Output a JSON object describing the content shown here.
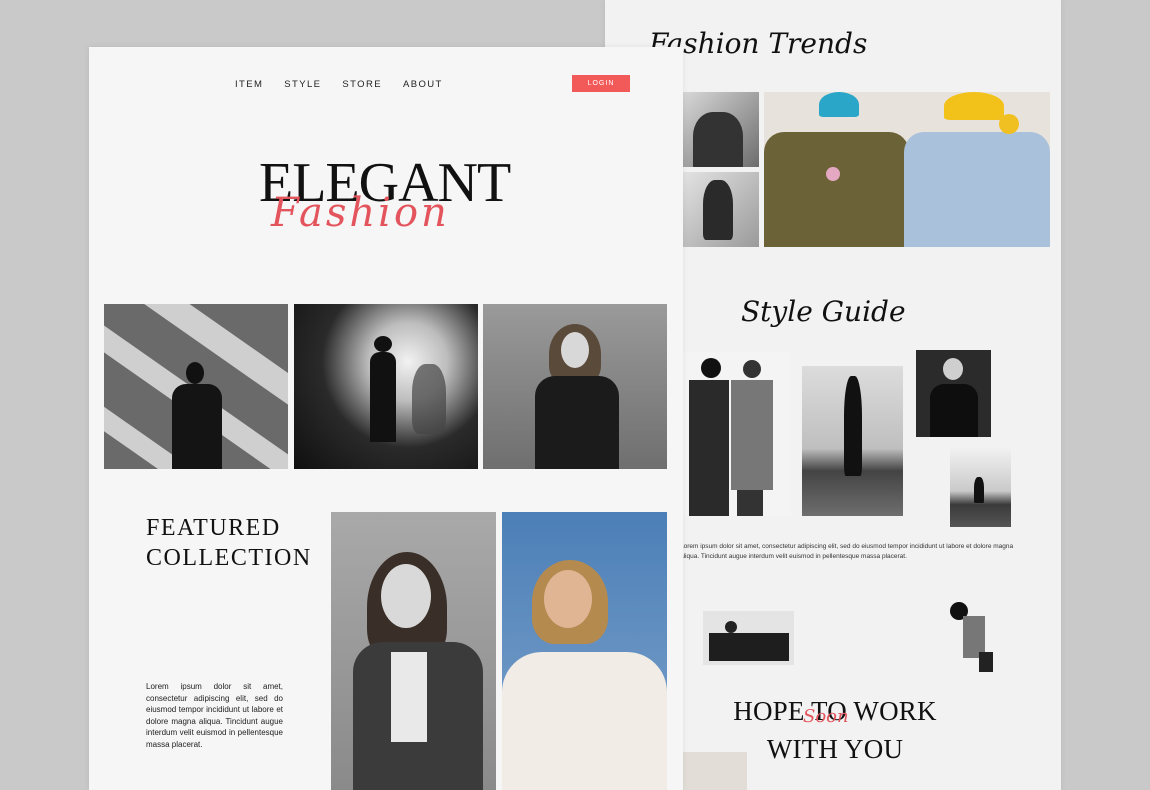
{
  "left_page": {
    "nav": [
      "ITEM",
      "STYLE",
      "STORE",
      "ABOUT"
    ],
    "login_label": "LOGIN",
    "hero_title": "ELEGANT",
    "hero_script": "Fashion",
    "featured_title_line1": "FEATURED",
    "featured_title_line2": "COLLECTION",
    "featured_text": "Lorem ipsum dolor sit amet, consectetur adipiscing elit, sed do eiusmod tempor incididunt ut labore et dolore magna aliqua. Tincidunt augue interdum velit euismod in pellentesque massa placerat."
  },
  "right_page": {
    "trends_title": "Fashion Trends",
    "style_title": "Style Guide",
    "style_text": "Lorem ipsum dolor sit amet, consectetur adipiscing elit, sed do eiusmod tempor incididunt ut labore et dolore magna aliqua. Tincidunt augue interdum velit euismod in pellentesque massa placerat.",
    "hope_line1": "HOPE TO WORK",
    "hope_script": "Soon",
    "hope_line2": "WITH YOU"
  },
  "colors": {
    "accent": "#f25a5a",
    "script_red": "#e3545c"
  }
}
